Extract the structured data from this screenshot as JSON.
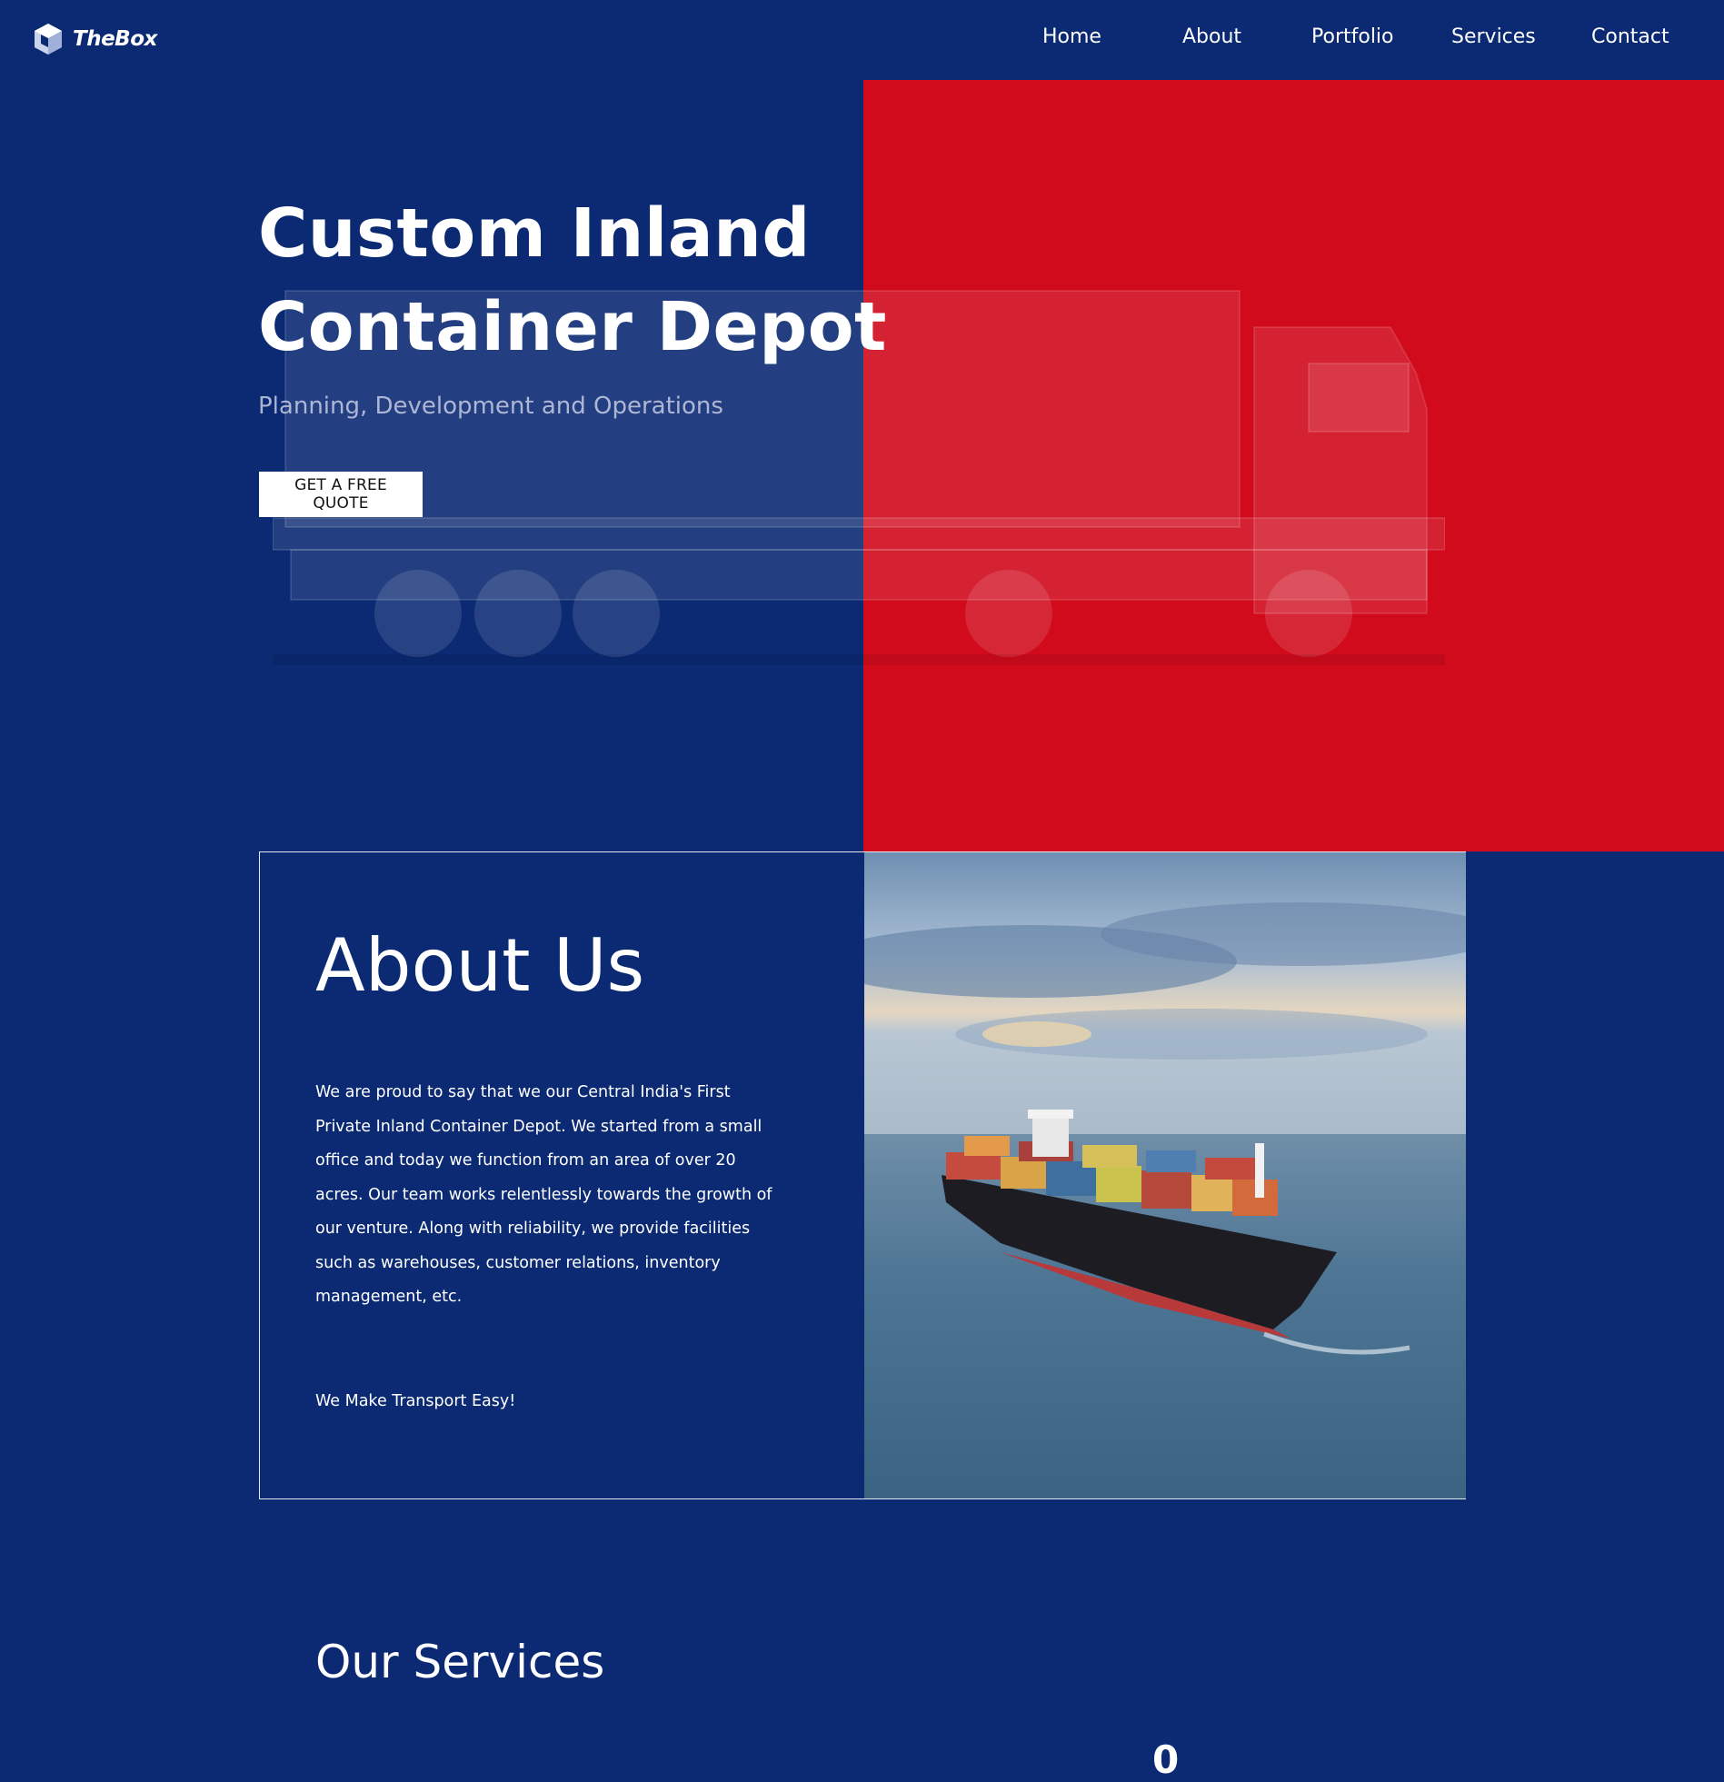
{
  "brand": {
    "name": "TheBox",
    "icon": "cube-logo-icon"
  },
  "nav": {
    "items": [
      "Home",
      "About",
      "Portfolio",
      "Services",
      "Contact"
    ]
  },
  "hero": {
    "title_line1": "Custom Inland",
    "title_line2": "Container Depot",
    "subtitle": "Planning, Development and Operations",
    "cta": "GET A FREE QUOTE",
    "colors": {
      "left": "#0b2a73",
      "right": "#d10a1c"
    }
  },
  "about": {
    "title": "About Us",
    "body": "We are proud to say that we our Central India's First Private Inland Container Depot. We started from a small office and today we function from an area of over 20 acres. Our team works relentlessly towards the growth of our venture. Along with reliability, we provide facilities such as warehouses, customer relations, inventory management, etc.",
    "tagline": "We Make Transport Easy!",
    "image": "container-ship-at-sea"
  },
  "services": {
    "title": "Our Services",
    "partial_stat": "0"
  }
}
